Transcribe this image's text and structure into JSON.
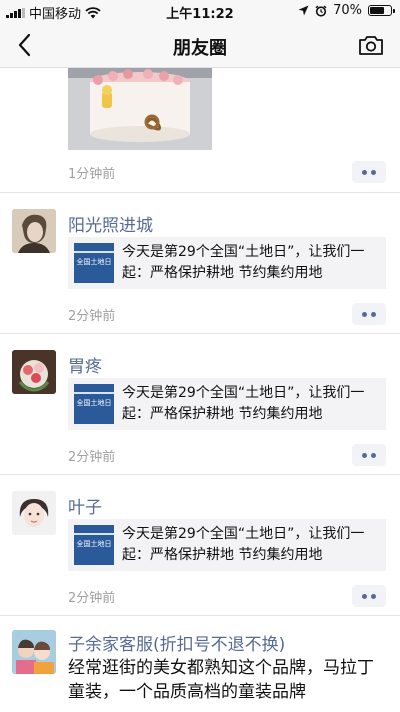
{
  "status_bar": {
    "carrier": "中国移动",
    "time": "上午11:22",
    "battery": "70%",
    "battery_level": 0.7,
    "icons": [
      "signal-icon",
      "wifi-icon",
      "location-icon",
      "alarm-icon",
      "battery-icon"
    ]
  },
  "nav": {
    "title": "朋友圈",
    "back_icon": "back-chevron-icon",
    "camera_icon": "camera-icon"
  },
  "feed": {
    "first_post": {
      "time": "1分钟前",
      "image": "cake-photo"
    },
    "link_posts": [
      {
        "name": "阳光照进城",
        "link_text": "今天是第29个全国“土地日”，让我们一起：严格保护耕地 节约集约用地",
        "thumb_label": "全国土地日",
        "time": "2分钟前"
      },
      {
        "name": "胃疼",
        "link_text": "今天是第29个全国“土地日”，让我们一起：严格保护耕地 节约集约用地",
        "thumb_label": "全国土地日",
        "time": "2分钟前"
      },
      {
        "name": "叶子",
        "link_text": "今天是第29个全国“土地日”，让我们一起：严格保护耕地 节约集约用地",
        "thumb_label": "全国土地日",
        "time": "2分钟前"
      }
    ],
    "last_post": {
      "name": "子余家客服(折扣号不退不换)",
      "text": "经常逛街的美女都熟知这个品牌，马拉丁童装，一个品质高档的童装品牌"
    }
  },
  "colors": {
    "name_link": "#576b95",
    "time_gray": "#a0a0a0",
    "bar_bg": "#f7f7f7",
    "link_card_bg": "#f3f3f5"
  }
}
